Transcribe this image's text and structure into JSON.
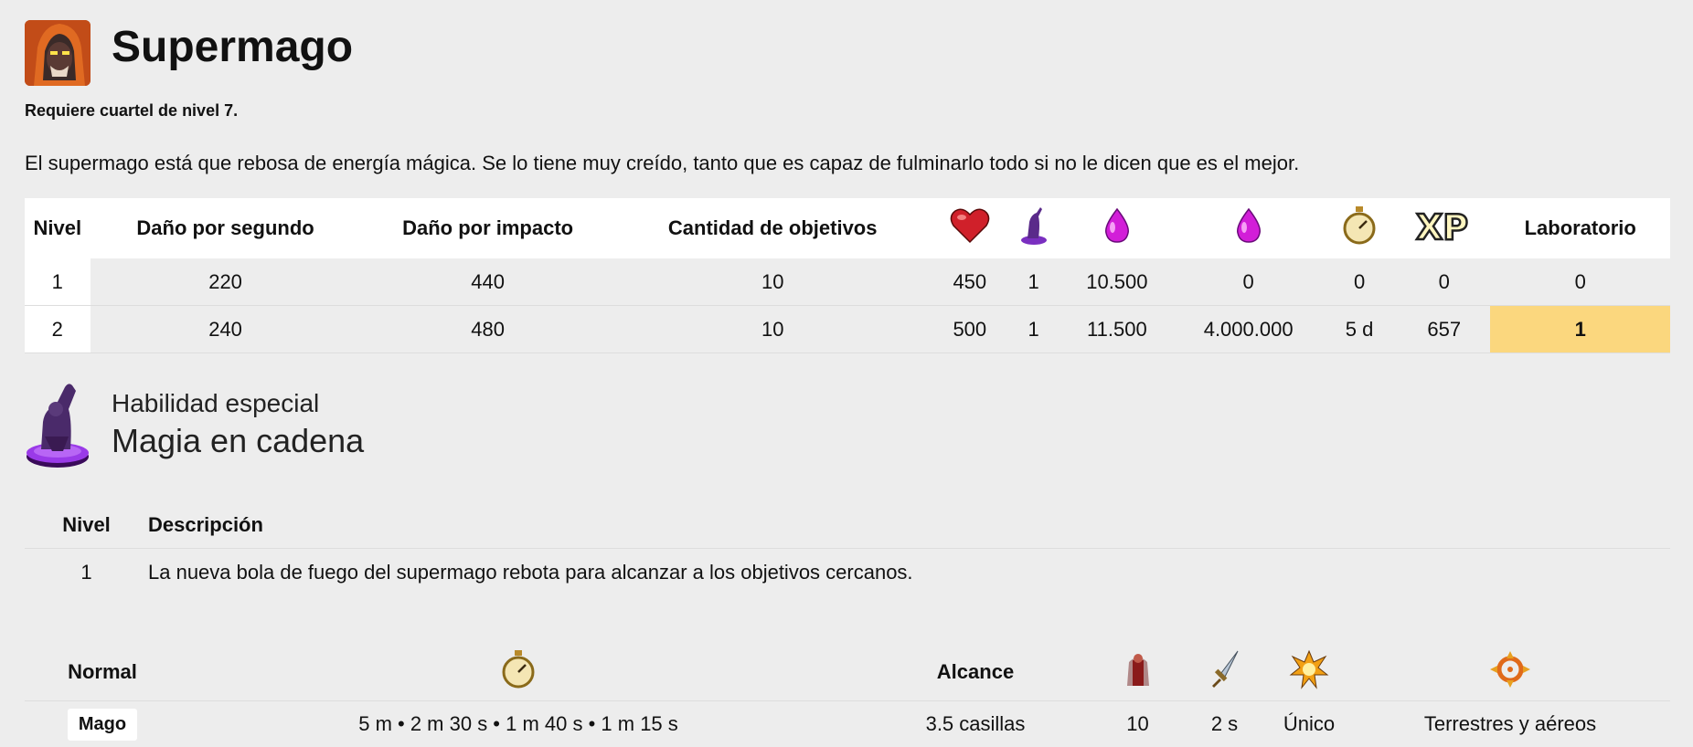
{
  "header": {
    "title": "Supermago",
    "avatar": "super-wizard-portrait",
    "requires": "Requiere cuartel de nivel 7.",
    "description": "El supermago está que rebosa de energía mágica. Se lo tiene muy creído, tanto que es capaz de fulminarlo todo si no le dicen que es el mejor."
  },
  "stats_table": {
    "headers": {
      "level": "Nivel",
      "dps": "Daño por segundo",
      "dph": "Daño por impacto",
      "targets": "Cantidad de objetivos",
      "hp_icon": "heart-icon",
      "housing_icon": "troop-housing-icon",
      "cost_icon": "elixir-icon",
      "upgrade_cost_icon": "elixir-icon",
      "time_icon": "stopwatch-icon",
      "xp_icon": "xp-icon",
      "lab": "Laboratorio"
    },
    "rows": [
      {
        "level": "1",
        "dps": "220",
        "dph": "440",
        "targets": "10",
        "hp": "450",
        "housing": "1",
        "cost": "10.500",
        "upgrade": "0",
        "time": "0",
        "xp": "0",
        "lab": "0",
        "highlight": false
      },
      {
        "level": "2",
        "dps": "240",
        "dph": "480",
        "targets": "10",
        "hp": "500",
        "housing": "1",
        "cost": "11.500",
        "upgrade": "4.000.000",
        "time": "5 d",
        "xp": "657",
        "lab": "1",
        "highlight": true
      }
    ]
  },
  "ability": {
    "kicker": "Habilidad especial",
    "name": "Magia en cadena",
    "icon": "chain-magic-figure-icon",
    "headers": {
      "level": "Nivel",
      "description": "Descripción"
    },
    "rows": [
      {
        "level": "1",
        "description": "La nueva bola de fuego del supermago rebota para alcanzar a los objetivos cercanos."
      }
    ]
  },
  "bottom_table": {
    "headers": {
      "mode": "Normal",
      "time_icon": "stopwatch-icon",
      "range": "Alcance",
      "housing_icon": "troop-silhouette-icon",
      "speed_icon": "sword-icon",
      "damage_icon": "explosion-icon",
      "target_icon": "crosshair-icon"
    },
    "rows": [
      {
        "mode": "Mago",
        "time": "5 m • 2 m 30 s • 1 m 40 s • 1 m 15 s",
        "range": "3.5 casillas",
        "housing": "10",
        "speed": "2 s",
        "damage": "Único",
        "targets": "Terrestres y aéreos"
      }
    ]
  }
}
